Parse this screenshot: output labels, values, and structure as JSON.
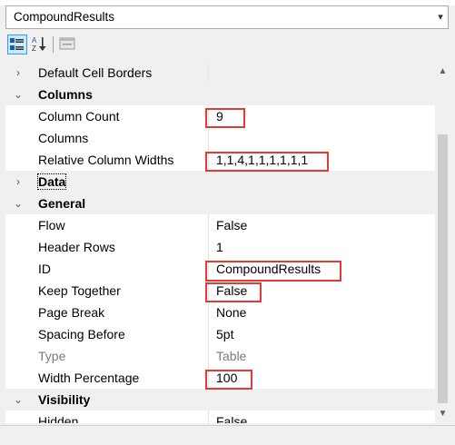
{
  "window": {
    "object_name": "CompoundResults"
  },
  "icons": {
    "dropdown_arrow": "chevron-down-icon",
    "categorized": "categorized-icon",
    "alphabetical": "sort-az-icon",
    "pages": "property-pages-icon"
  },
  "grid": {
    "rows": {
      "default_cell_borders": {
        "name": "Default Cell Borders",
        "value": ""
      },
      "columns_cat": {
        "name": "Columns"
      },
      "column_count": {
        "name": "Column Count",
        "value": "9"
      },
      "columns": {
        "name": "Columns",
        "value": ""
      },
      "relative_widths": {
        "name": "Relative Column Widths",
        "value": "1,1,4,1,1,1,1,1,1"
      },
      "data_cat": {
        "name": "Data"
      },
      "general_cat": {
        "name": "General"
      },
      "flow": {
        "name": "Flow",
        "value": "False"
      },
      "header_rows": {
        "name": "Header Rows",
        "value": "1"
      },
      "id": {
        "name": "ID",
        "value": "CompoundResults"
      },
      "keep_together": {
        "name": "Keep Together",
        "value": "False"
      },
      "page_break": {
        "name": "Page Break",
        "value": "None"
      },
      "spacing_before": {
        "name": "Spacing Before",
        "value": "5pt"
      },
      "type": {
        "name": "Type",
        "value": "Table"
      },
      "width_percentage": {
        "name": "Width Percentage",
        "value": "100"
      },
      "visibility_cat": {
        "name": "Visibility"
      },
      "hidden": {
        "name": "Hidden",
        "value": "False"
      }
    }
  },
  "colors": {
    "highlight": "#e53935",
    "category_bg": "#f0f0f0",
    "toolbar_active": "#cce8ff"
  }
}
